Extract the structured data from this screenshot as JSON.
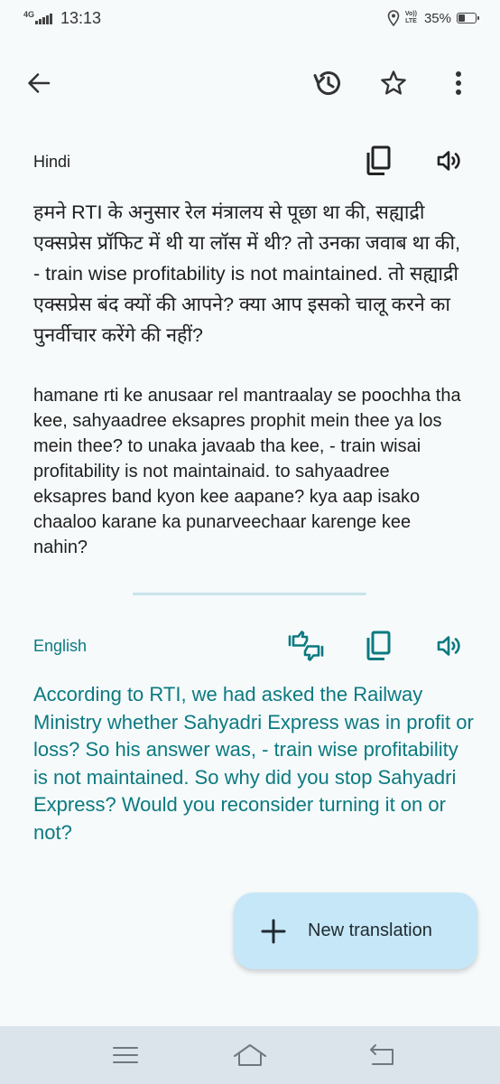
{
  "status_bar": {
    "network": "4G",
    "time": "13:13",
    "volte_top": "Vo))",
    "volte_bottom": "LTE",
    "battery_percent_text": "35%",
    "battery_level": 0.35
  },
  "toolbar": {
    "back_icon": "arrow-left-icon",
    "history_icon": "history-icon",
    "star_icon": "star-outline-icon",
    "more_icon": "more-vert-icon"
  },
  "source": {
    "language": "Hindi",
    "text": "हमने RTI के अनुसार रेल मंत्रालय से पूछा था की, सह्याद्री एक्सप्रेस प्रॉफिट में थी या लॉस में थी? तो उनका जवाब था की, - train wise profitability is not maintained. तो सह्याद्री एक्सप्रेस बंद क्यों की आपने? क्या आप इसको चालू करने का पुनर्वीचार करेंगे की नहीं?",
    "transliteration": "hamane rti ke anusaar rel mantraalay se poochha tha kee, sahyaadree eksapres prophit mein thee ya los mein thee? to unaka javaab tha kee, - train wisai profitability is not maintainaid. to sahyaadree eksapres band kyon kee aapane? kya aap isako chaaloo karane ka punarveechaar karenge kee nahin?",
    "copy_icon": "copy-icon",
    "speaker_icon": "speaker-icon"
  },
  "target": {
    "language": "English",
    "text": "According to RTI, we had asked the Railway Ministry whether Sahyadri Express was in profit or loss?  So his answer was, - train wise profitability is not maintained. So why did you stop Sahyadri Express? Would you reconsider turning it on or not?",
    "feedback_icon": "thumbs-feedback-icon",
    "copy_icon": "copy-icon",
    "speaker_icon": "speaker-icon",
    "accent_color": "#0b7a80"
  },
  "fab": {
    "label": "New translation",
    "icon": "plus-icon",
    "background": "#c6e7f7"
  },
  "nav_bar": {
    "menu_icon": "menu-icon",
    "home_icon": "home-icon",
    "back_icon": "return-icon"
  }
}
